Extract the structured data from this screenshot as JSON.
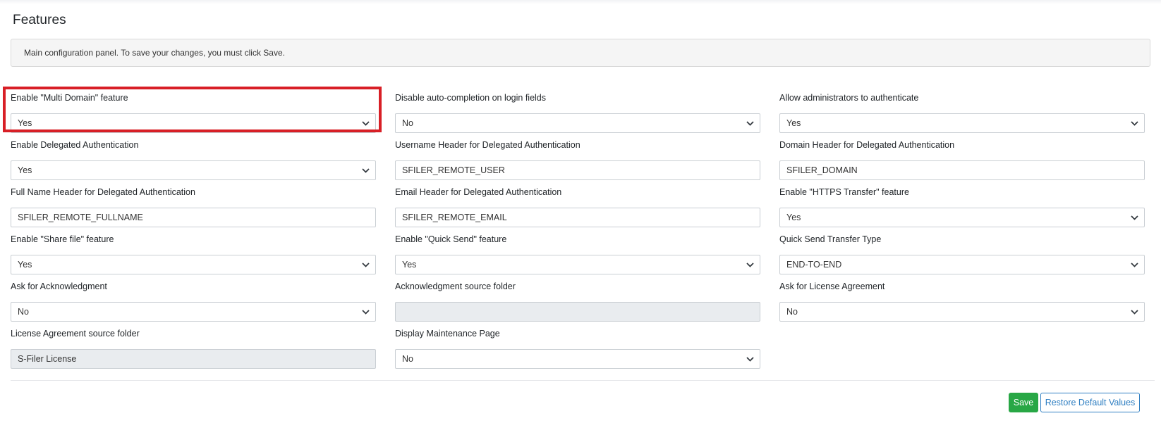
{
  "page": {
    "title": "Features",
    "info": "Main configuration panel. To save your changes, you must click Save."
  },
  "fields": [
    {
      "label": "Enable \"Multi Domain\" feature",
      "type": "select",
      "value": "Yes"
    },
    {
      "label": "Disable auto-completion on login fields",
      "type": "select",
      "value": "No"
    },
    {
      "label": "Allow administrators to authenticate",
      "type": "select",
      "value": "Yes"
    },
    {
      "label": "Enable Delegated Authentication",
      "type": "select",
      "value": "Yes"
    },
    {
      "label": "Username Header for Delegated Authentication",
      "type": "text",
      "value": "SFILER_REMOTE_USER"
    },
    {
      "label": "Domain Header for Delegated Authentication",
      "type": "text",
      "value": "SFILER_DOMAIN"
    },
    {
      "label": "Full Name Header for Delegated Authentication",
      "type": "text",
      "value": "SFILER_REMOTE_FULLNAME"
    },
    {
      "label": "Email Header for Delegated Authentication",
      "type": "text",
      "value": "SFILER_REMOTE_EMAIL"
    },
    {
      "label": "Enable \"HTTPS Transfer\" feature",
      "type": "select",
      "value": "Yes"
    },
    {
      "label": "Enable \"Share file\" feature",
      "type": "select",
      "value": "Yes"
    },
    {
      "label": "Enable \"Quick Send\" feature",
      "type": "select",
      "value": "Yes"
    },
    {
      "label": "Quick Send Transfer Type",
      "type": "select",
      "value": "END-TO-END"
    },
    {
      "label": "Ask for Acknowledgment",
      "type": "select",
      "value": "No"
    },
    {
      "label": "Acknowledgment source folder",
      "type": "text-disabled",
      "value": ""
    },
    {
      "label": "Ask for License Agreement",
      "type": "select",
      "value": "No"
    },
    {
      "label": "License Agreement source folder",
      "type": "text-disabled",
      "value": "S-Filer License"
    },
    {
      "label": "Display Maintenance Page",
      "type": "select",
      "value": "No"
    }
  ],
  "icons": {
    "select_arrow": "chevron-down-icon"
  },
  "buttons": {
    "save": "Save",
    "restore": "Restore Default Values"
  },
  "colors": {
    "highlight": "#d81f26",
    "save": "#28a745",
    "restore": "#2f7fc2",
    "disabled_bg": "#e9ecef"
  }
}
